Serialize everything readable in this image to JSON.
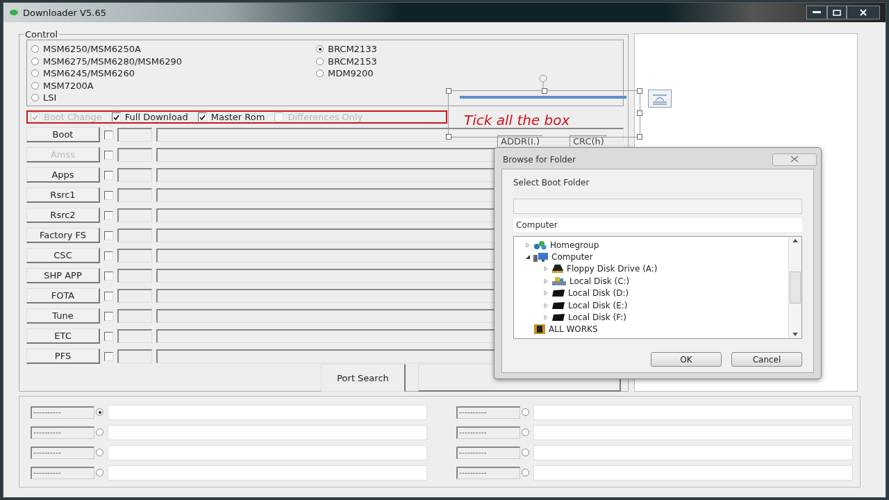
{
  "window": {
    "title": "Downloader V5.65"
  },
  "control": {
    "legend": "Control",
    "chips_left": [
      {
        "label": "MSM6250/MSM6250A",
        "selected": false
      },
      {
        "label": "MSM6275/MSM6280/MSM6290",
        "selected": false
      },
      {
        "label": "MSM6245/MSM6260",
        "selected": false
      },
      {
        "label": "MSM7200A",
        "selected": false
      },
      {
        "label": "LSI",
        "selected": false
      }
    ],
    "chips_right": [
      {
        "label": "BRCM2133",
        "selected": true
      },
      {
        "label": "BRCM2153",
        "selected": false
      },
      {
        "label": "MDM9200",
        "selected": false
      }
    ],
    "options": [
      {
        "label": "Boot Change",
        "checked": true,
        "disabled": true
      },
      {
        "label": "Full Download",
        "checked": true,
        "disabled": false
      },
      {
        "label": "Master Rom",
        "checked": true,
        "disabled": false
      },
      {
        "label": "Differences Only",
        "checked": false,
        "disabled": true
      }
    ],
    "column_headers": [
      "ADDR(I.)",
      "CRC(h)"
    ],
    "files": [
      {
        "label": "Boot",
        "disabled": false,
        "checked": false
      },
      {
        "label": "Amss",
        "disabled": true,
        "checked": false
      },
      {
        "label": "Apps",
        "disabled": false,
        "checked": false
      },
      {
        "label": "Rsrc1",
        "disabled": false,
        "checked": false
      },
      {
        "label": "Rsrc2",
        "disabled": false,
        "checked": false
      },
      {
        "label": "Factory FS",
        "disabled": false,
        "checked": false
      },
      {
        "label": "CSC",
        "disabled": false,
        "checked": false
      },
      {
        "label": "SHP APP",
        "disabled": false,
        "checked": false
      },
      {
        "label": "FOTA",
        "disabled": false,
        "checked": false
      },
      {
        "label": "Tune",
        "disabled": false,
        "checked": false
      },
      {
        "label": "ETC",
        "disabled": false,
        "checked": false
      },
      {
        "label": "PFS",
        "disabled": false,
        "checked": false
      }
    ],
    "port_search": "Port Search"
  },
  "annotation": {
    "text": "Tick all the box"
  },
  "ports": [
    {
      "label": "----------",
      "selected": true
    },
    {
      "label": "----------",
      "selected": false
    },
    {
      "label": "----------",
      "selected": false
    },
    {
      "label": "----------",
      "selected": false
    },
    {
      "label": "----------",
      "selected": false
    },
    {
      "label": "----------",
      "selected": false
    },
    {
      "label": "----------",
      "selected": false
    },
    {
      "label": "----------",
      "selected": false
    }
  ],
  "dialog": {
    "title": "Browse for Folder",
    "prompt": "Select Boot Folder",
    "path": "Computer",
    "tree": [
      {
        "label": "Homegroup",
        "kind": "network",
        "expanded": false
      },
      {
        "label": "Computer",
        "kind": "computer",
        "expanded": true,
        "children": [
          {
            "label": "Floppy Disk Drive (A:)",
            "kind": "floppy",
            "expanded": false
          },
          {
            "label": "Local Disk (C:)",
            "kind": "system",
            "expanded": false
          },
          {
            "label": "Local Disk (D:)",
            "kind": "disk",
            "expanded": false
          },
          {
            "label": "Local Disk (E:)",
            "kind": "disk",
            "expanded": false
          },
          {
            "label": "Local Disk (F:)",
            "kind": "disk",
            "expanded": false
          }
        ]
      },
      {
        "label": "ALL WORKS",
        "kind": "folder"
      }
    ],
    "buttons": [
      "OK",
      "Cancel"
    ]
  }
}
